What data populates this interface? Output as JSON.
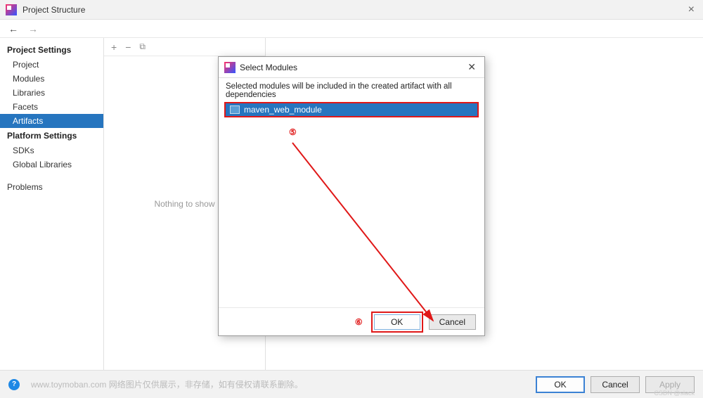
{
  "window": {
    "title": "Project Structure"
  },
  "sidebar": {
    "sections": [
      {
        "heading": "Project Settings",
        "items": [
          {
            "label": "Project",
            "selected": false
          },
          {
            "label": "Modules",
            "selected": false
          },
          {
            "label": "Libraries",
            "selected": false
          },
          {
            "label": "Facets",
            "selected": false
          },
          {
            "label": "Artifacts",
            "selected": true
          }
        ]
      },
      {
        "heading": "Platform Settings",
        "items": [
          {
            "label": "SDKs",
            "selected": false
          },
          {
            "label": "Global Libraries",
            "selected": false
          }
        ]
      },
      {
        "heading": "",
        "items": [
          {
            "label": "Problems",
            "selected": false
          }
        ]
      }
    ]
  },
  "mid_panel": {
    "toolbar_icons": [
      "plus-icon",
      "minus-icon",
      "copy-icon"
    ],
    "empty_text": "Nothing to show"
  },
  "footer": {
    "watermark": "www.toymoban.com 网络图片仅供展示，非存储，如有侵权请联系删除。",
    "sub_watermark": "CSDN @slack",
    "ok_label": "OK",
    "cancel_label": "Cancel",
    "apply_label": "Apply"
  },
  "dialog": {
    "title": "Select Modules",
    "description": "Selected modules will be included in the created artifact with all dependencies",
    "items": [
      {
        "label": "maven_web_module",
        "selected": true
      }
    ],
    "annotations": {
      "step5": "⑤",
      "step6": "⑥"
    },
    "ok_label": "OK",
    "cancel_label": "Cancel"
  }
}
